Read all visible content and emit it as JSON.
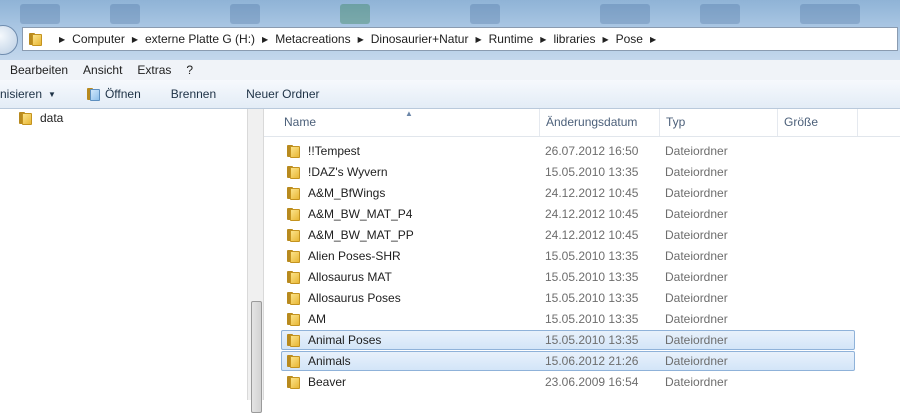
{
  "address": {
    "crumbs": [
      "Computer",
      "externe Platte G (H:)",
      "Metacreations",
      "Dinosaurier+Natur",
      "Runtime",
      "libraries",
      "Pose"
    ]
  },
  "menu": {
    "items": [
      "Bearbeiten",
      "Ansicht",
      "Extras",
      "?"
    ]
  },
  "toolbar": {
    "organize": "nisieren",
    "open": "Öffnen",
    "burn": "Brennen",
    "new_folder": "Neuer Ordner"
  },
  "nav": {
    "items": [
      {
        "label": "data"
      }
    ]
  },
  "columns": {
    "name": "Name",
    "date": "Änderungsdatum",
    "type": "Typ",
    "size": "Größe"
  },
  "files": [
    {
      "name": "!!Tempest",
      "date": "26.07.2012 16:50",
      "type": "Dateiordner",
      "selected": false
    },
    {
      "name": "!DAZ's Wyvern",
      "date": "15.05.2010 13:35",
      "type": "Dateiordner",
      "selected": false
    },
    {
      "name": "A&M_BfWings",
      "date": "24.12.2012 10:45",
      "type": "Dateiordner",
      "selected": false
    },
    {
      "name": "A&M_BW_MAT_P4",
      "date": "24.12.2012 10:45",
      "type": "Dateiordner",
      "selected": false
    },
    {
      "name": "A&M_BW_MAT_PP",
      "date": "24.12.2012 10:45",
      "type": "Dateiordner",
      "selected": false
    },
    {
      "name": "Alien Poses-SHR",
      "date": "15.05.2010 13:35",
      "type": "Dateiordner",
      "selected": false
    },
    {
      "name": "Allosaurus MAT",
      "date": "15.05.2010 13:35",
      "type": "Dateiordner",
      "selected": false
    },
    {
      "name": "Allosaurus Poses",
      "date": "15.05.2010 13:35",
      "type": "Dateiordner",
      "selected": false
    },
    {
      "name": "AM",
      "date": "15.05.2010 13:35",
      "type": "Dateiordner",
      "selected": false
    },
    {
      "name": "Animal Poses",
      "date": "15.05.2010 13:35",
      "type": "Dateiordner",
      "selected": true
    },
    {
      "name": "Animals",
      "date": "15.06.2012 21:26",
      "type": "Dateiordner",
      "selected": true
    },
    {
      "name": "Beaver",
      "date": "23.06.2009 16:54",
      "type": "Dateiordner",
      "selected": false
    }
  ],
  "colors": {
    "selection_fill": "#d3e5f8",
    "selection_border": "#8fb2d9",
    "folder_yellow": "#e8b735"
  }
}
